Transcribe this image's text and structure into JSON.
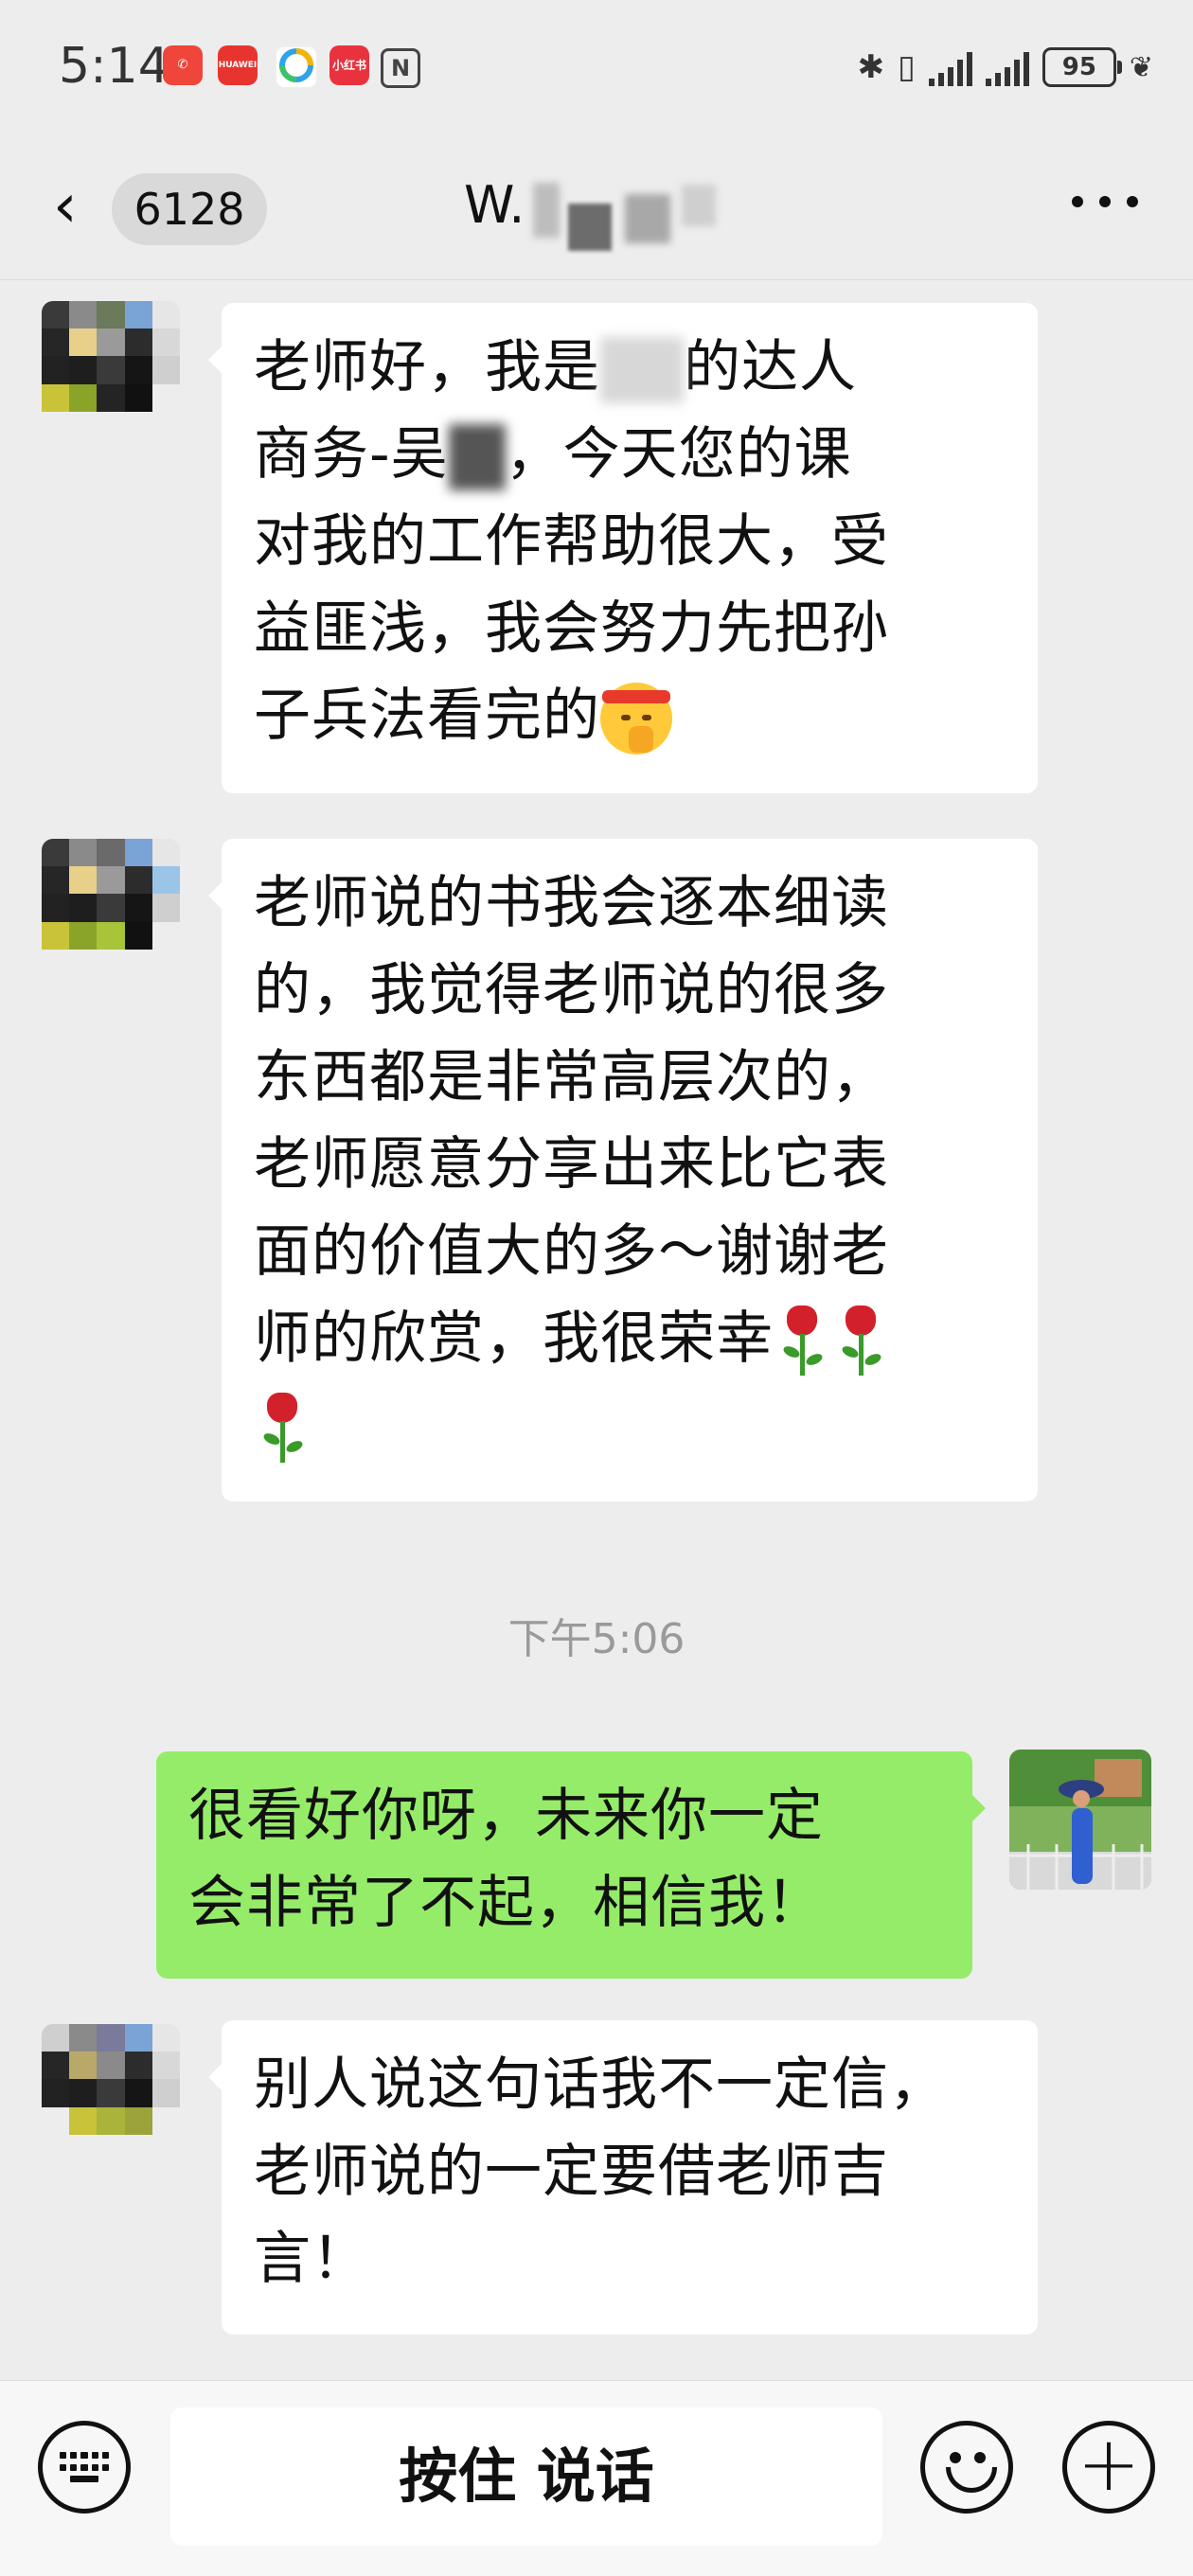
{
  "status_bar": {
    "time": "5:14",
    "notif_icons": [
      "missed-call-icon",
      "huawei-app-icon",
      "browser-app-icon",
      "xiaohongshu-app-icon",
      "nfc-icon"
    ],
    "notif_labels": [
      "",
      "HUAWEI",
      "",
      "小红书",
      "N"
    ],
    "battery": "95"
  },
  "nav": {
    "unread_count": "6128",
    "title_visible": "W."
  },
  "messages": [
    {
      "side": "in",
      "text_parts": [
        "老师好，我是",
        "的达人",
        "商务-吴",
        "，今天您的课对我的工作帮助很大，受益匪浅，我会努力先把孙子兵法看完的"
      ],
      "p1": "老师好，我是",
      "p2": "的达人",
      "p3": "商务-吴",
      "p4": "，今天您的课",
      "p5": "对我的工作帮助很大，受",
      "p6": "益匪浅，我会努力先把孙",
      "p7": "子兵法看完的"
    },
    {
      "side": "in",
      "l1": "老师说的书我会逐本细读",
      "l2": "的，我觉得老师说的很多",
      "l3": "东西都是非常高层次的，",
      "l4": "老师愿意分享出来比它表",
      "l5": "面的价值大的多～谢谢老",
      "l6": "师的欣赏，我很荣幸"
    },
    {
      "side": "out",
      "l1": "很看好你呀，未来你一定",
      "l2": "会非常了不起，相信我！"
    },
    {
      "side": "in",
      "l1": "别人说这句话我不一定信，",
      "l2": "老师说的一定要借老师吉",
      "l3": "言！"
    }
  ],
  "timestamp": "下午5:06",
  "input_bar": {
    "hold_to_talk": "按住 说话"
  },
  "colors": {
    "background": "#ededed",
    "bubble_in": "#ffffff",
    "bubble_out": "#95ec69",
    "timestamp": "#9a9a9a"
  }
}
